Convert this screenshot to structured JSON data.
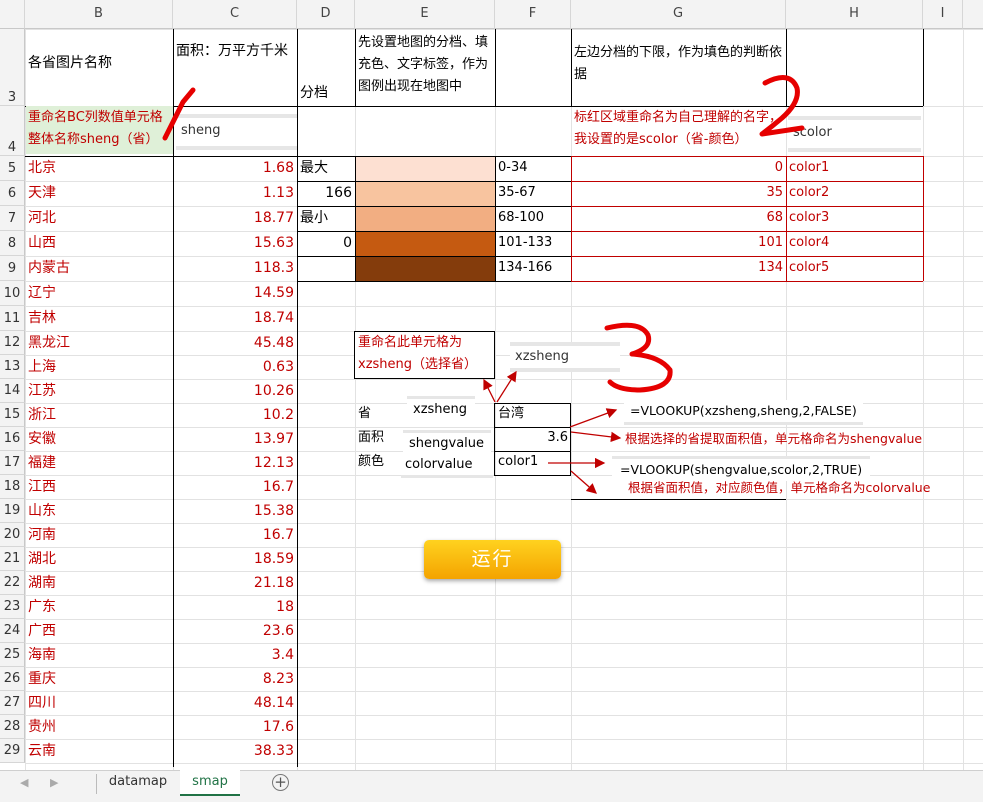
{
  "columns": [
    "B",
    "C",
    "D",
    "E",
    "F",
    "G",
    "H",
    "I"
  ],
  "rows": [
    "3",
    "4",
    "5",
    "6",
    "7",
    "8",
    "9",
    "10",
    "11",
    "12",
    "13",
    "14",
    "15",
    "16",
    "17",
    "18",
    "19",
    "20",
    "21",
    "22",
    "23",
    "24",
    "25",
    "26",
    "27",
    "28",
    "29"
  ],
  "header_row": {
    "b3": "各省图片名称",
    "c3": "面积：万平方千米",
    "d3": "分档",
    "e3": "先设置地图的分档、填充色、文字标签，作为图例出现在地图中",
    "g3": "左边分档的下限，作为填色的判断依据"
  },
  "row4": {
    "b4": "重命名BC列数值单元格整体名称sheng（省）",
    "c4_box": "sheng",
    "g4": "标红区域重命名为自己理解的名字，我设置的是scolor（省-颜色）",
    "h4_box": "scolor"
  },
  "provinces": [
    {
      "name": "北京",
      "area": "1.68"
    },
    {
      "name": "天津",
      "area": "1.13"
    },
    {
      "name": "河北",
      "area": "18.77"
    },
    {
      "name": "山西",
      "area": "15.63"
    },
    {
      "name": "内蒙古",
      "area": "118.3"
    },
    {
      "name": "辽宁",
      "area": "14.59"
    },
    {
      "name": "吉林",
      "area": "18.74"
    },
    {
      "name": "黑龙江",
      "area": "45.48"
    },
    {
      "name": "上海",
      "area": "0.63"
    },
    {
      "name": "江苏",
      "area": "10.26"
    },
    {
      "name": "浙江",
      "area": "10.2"
    },
    {
      "name": "安徽",
      "area": "13.97"
    },
    {
      "name": "福建",
      "area": "12.13"
    },
    {
      "name": "江西",
      "area": "16.7"
    },
    {
      "name": "山东",
      "area": "15.38"
    },
    {
      "name": "河南",
      "area": "16.7"
    },
    {
      "name": "湖北",
      "area": "18.59"
    },
    {
      "name": "湖南",
      "area": "21.18"
    },
    {
      "name": "广东",
      "area": "18"
    },
    {
      "name": "广西",
      "area": "23.6"
    },
    {
      "name": "海南",
      "area": "3.4"
    },
    {
      "name": "重庆",
      "area": "8.23"
    },
    {
      "name": "四川",
      "area": "48.14"
    },
    {
      "name": "贵州",
      "area": "17.6"
    },
    {
      "name": "云南",
      "area": "38.33"
    }
  ],
  "legend": [
    {
      "d": "最大",
      "color": "#fde0d2",
      "range": "0-34",
      "lower": "0",
      "name": "color1"
    },
    {
      "d": "166",
      "color": "#f8c49f",
      "range": "35-67",
      "lower": "35",
      "name": "color2"
    },
    {
      "d": "最小",
      "color": "#f2ae82",
      "range": "68-100",
      "lower": "68",
      "name": "color3"
    },
    {
      "d": "0",
      "color": "#c55a11",
      "range": "101-133",
      "lower": "101",
      "name": "color4"
    },
    {
      "d": "",
      "color": "#843c0c",
      "range": "134-166",
      "lower": "134",
      "name": "color5"
    }
  ],
  "rename_note": "重命名此单元格为xzsheng（选择省）",
  "xzsheng_box": "xzsheng",
  "lookup": {
    "label_prov": "省",
    "label_area": "面积",
    "label_color": "颜色",
    "name_xz": "xzsheng",
    "name_sv": "shengvalue",
    "name_cv": "colorvalue",
    "prov_value": "台湾",
    "area_value": "3.6",
    "color_value": "color1"
  },
  "formulas": {
    "f1": "=VLOOKUP(xzsheng,sheng,2,FALSE)",
    "n1": "根据选择的省提取面积值，单元格命名为shengvalue",
    "f2": "=VLOOKUP(shengvalue,scolor,2,TRUE)",
    "n2": "根据省面积值，对应颜色值，单元格命名为colorvalue"
  },
  "run_button": "运行",
  "tabs": {
    "t1": "datamap",
    "t2": "smap"
  },
  "annotations": {
    "a1": "1",
    "a2": "2",
    "a3": "3"
  }
}
